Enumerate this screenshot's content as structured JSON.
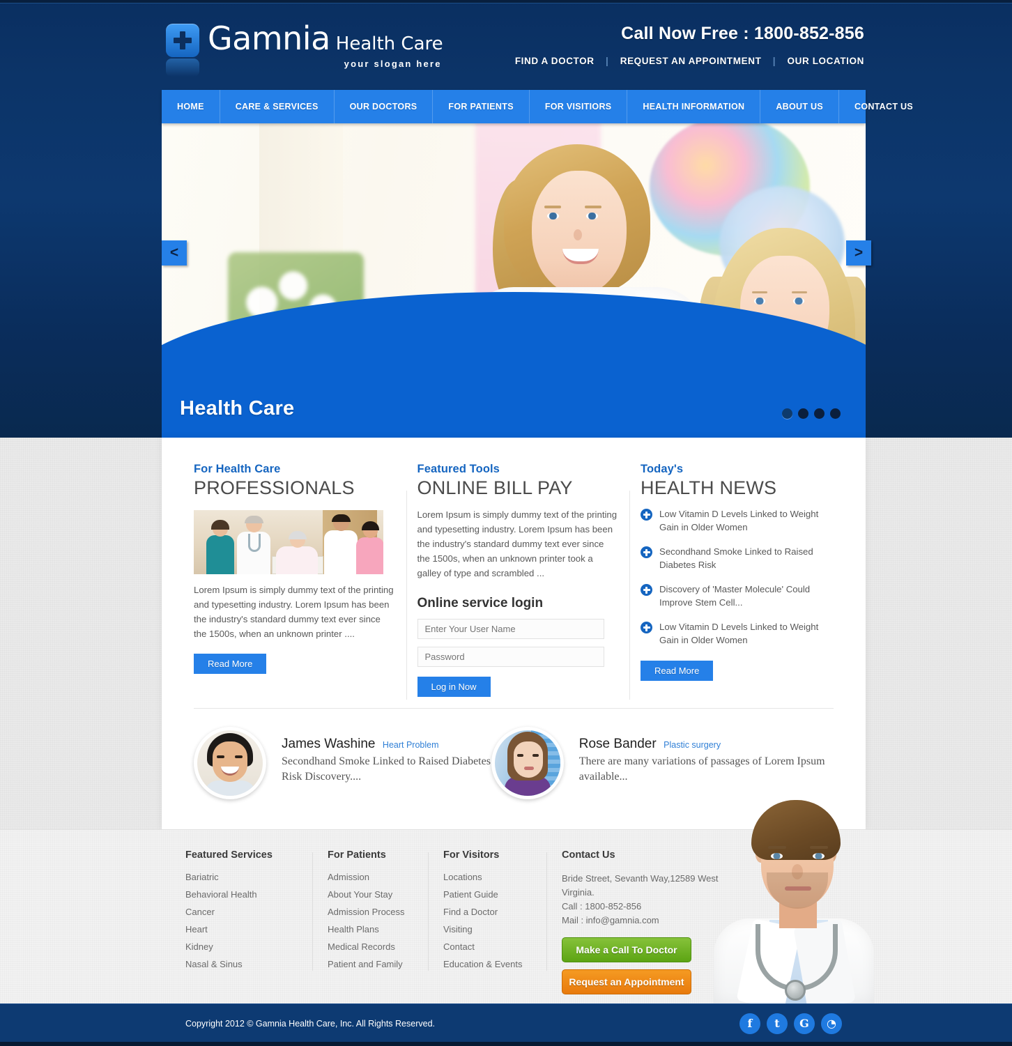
{
  "brand": {
    "name": "Gamnia",
    "sub": "Health Care",
    "slogan": "your slogan here",
    "logo_icon": "medical-cross-icon",
    "accent_blue": "#2580e8",
    "header_navy": "#0d386f"
  },
  "header": {
    "call_now": "Call Now Free : 1800-852-856",
    "links": [
      {
        "label": "FIND A DOCTOR"
      },
      {
        "label": "REQUEST AN APPOINTMENT"
      },
      {
        "label": "OUR LOCATION"
      }
    ]
  },
  "nav": {
    "items": [
      {
        "label": "HOME"
      },
      {
        "label": "CARE & SERVICES"
      },
      {
        "label": "OUR DOCTORS"
      },
      {
        "label": "FOR PATIENTS"
      },
      {
        "label": "FOR VISITIORS"
      },
      {
        "label": "HEALTH INFORMATION"
      },
      {
        "label": "ABOUT US"
      },
      {
        "label": "CONTACT US"
      }
    ]
  },
  "slider": {
    "caption": "Health Care",
    "prev_label": "<",
    "next_label": ">",
    "dots": 4,
    "active_dot": 1,
    "image_alt": "Smiling nurse with blonde hair and a young blonde girl in a clinic room with flowers and balloons"
  },
  "columns": {
    "professionals": {
      "eyebrow": "For Health Care",
      "headline": "PROFESSIONALS",
      "image_alt": "Group of five medical staff standing around an elderly patient in a hospital bed",
      "body": "Lorem Ipsum is simply dummy text of the printing and typesetting industry. Lorem Ipsum has been the industry's standard dummy text ever since the 1500s, when an unknown printer ....",
      "button": "Read More"
    },
    "bill_pay": {
      "eyebrow": "Featured Tools",
      "headline": "ONLINE BILL PAY",
      "body": "Lorem Ipsum is simply dummy text of the printing and typesetting industry. Lorem Ipsum has been the industry's standard dummy text ever since the 1500s, when an unknown printer took a galley of type and scrambled ...",
      "login_heading": "Online service login",
      "username_placeholder": "Enter Your User Name",
      "password_placeholder": "Password",
      "button": "Log in Now"
    },
    "health_news": {
      "eyebrow": "Today's",
      "headline": "HEALTH NEWS",
      "items": [
        "Low Vitamin D Levels Linked to Weight Gain in Older Women",
        "Secondhand Smoke Linked to Raised Diabetes Risk",
        "Discovery of 'Master Molecule' Could Improve Stem Cell...",
        "Low Vitamin D Levels Linked to Weight Gain in Older Women"
      ],
      "bullet_icon": "plus-circle-icon",
      "button": "Read More"
    }
  },
  "testimonials": [
    {
      "name": "James Washine",
      "role": "Heart Problem",
      "text": "Secondhand Smoke Linked to Raised Diabetes Risk Discovery....",
      "avatar_alt": "Smiling middle-aged man with dark hair"
    },
    {
      "name": "Rose Bander",
      "role": "Plastic surgery",
      "text": "There are many variations of passages of Lorem Ipsum available...",
      "avatar_alt": "Young woman with long brown hair in a purple top against a blue window"
    }
  ],
  "footer": {
    "featured_services": {
      "heading": "Featured Services",
      "items": [
        "Bariatric",
        "Behavioral Health",
        "Cancer",
        "Heart",
        "Kidney",
        "Nasal & Sinus"
      ]
    },
    "for_patients": {
      "heading": "For Patients",
      "items": [
        "Admission",
        "About Your Stay",
        "Admission Process",
        "Health Plans",
        "Medical Records",
        "Patient and Family"
      ]
    },
    "for_visitors": {
      "heading": "For Visitors",
      "items": [
        "Locations",
        "Patient Guide",
        "Find a Doctor",
        "Visiting",
        "Contact",
        "Education & Events"
      ]
    },
    "contact": {
      "heading": "Contact Us",
      "address": "Bride Street, Sevanth Way,12589 West Virginia.",
      "phone": "Call : 1800-852-856",
      "mail": "Mail : info@gamnia.com",
      "call_button": "Make a Call To Doctor",
      "appointment_button": "Request an Appointment",
      "call_button_color": "#5ca413",
      "appointment_button_color": "#e87a0d"
    },
    "doctor_image_alt": "Male doctor in white coat with stethoscope"
  },
  "copyright": {
    "text": "Copyright 2012 © Gamnia Health Care, Inc. All Rights Reserved.",
    "socials": [
      {
        "icon": "facebook-icon",
        "glyph": "f"
      },
      {
        "icon": "twitter-icon",
        "glyph": "t"
      },
      {
        "icon": "google-icon",
        "glyph": "G"
      },
      {
        "icon": "rss-icon",
        "glyph": "◔"
      }
    ]
  }
}
